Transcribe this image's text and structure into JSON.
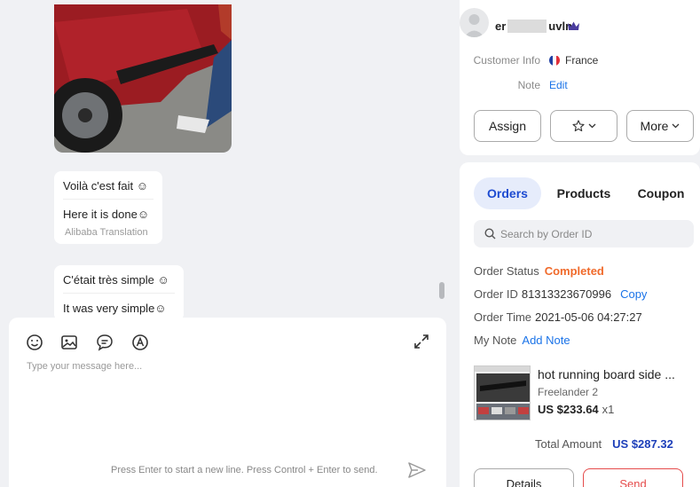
{
  "chat": {
    "messages": [
      {
        "original": "Voilà c'est fait ☺",
        "translation": "Here it is done☺",
        "translation_source": "Alibaba Translation"
      },
      {
        "original": "C'était très simple ☺",
        "translation": "It was very simple☺"
      }
    ],
    "composer": {
      "placeholder": "Type your message here...",
      "hint": "Press Enter to start a new line. Press Control + Enter to send."
    }
  },
  "customer": {
    "name_prefix": "er",
    "name_suffix": "uvln",
    "info_label": "Customer Info",
    "country": "France",
    "note_label": "Note",
    "note_action": "Edit",
    "buttons": {
      "assign": "Assign",
      "more": "More"
    }
  },
  "orders_panel": {
    "tabs": [
      "Orders",
      "Products",
      "Coupon"
    ],
    "active_tab": "Orders",
    "search_placeholder": "Search by Order ID",
    "order": {
      "status_label": "Order Status",
      "status": "Completed",
      "id_label": "Order ID",
      "id": "81313323670996",
      "copy_label": "Copy",
      "time_label": "Order Time",
      "time": "2021-05-06 04:27:27",
      "note_label": "My Note",
      "note_action": "Add Note",
      "product": {
        "title": "hot running board side ...",
        "variant": "Freelander 2",
        "price": "US $233.64",
        "qty": "x1"
      },
      "total_label": "Total Amount",
      "total": "US $287.32"
    },
    "buttons": {
      "details": "Details",
      "send": "Send"
    }
  },
  "colors": {
    "accent": "#1d4bd1",
    "status_completed": "#f06a2b",
    "send": "#e54b4b",
    "link": "#1a73e8"
  }
}
